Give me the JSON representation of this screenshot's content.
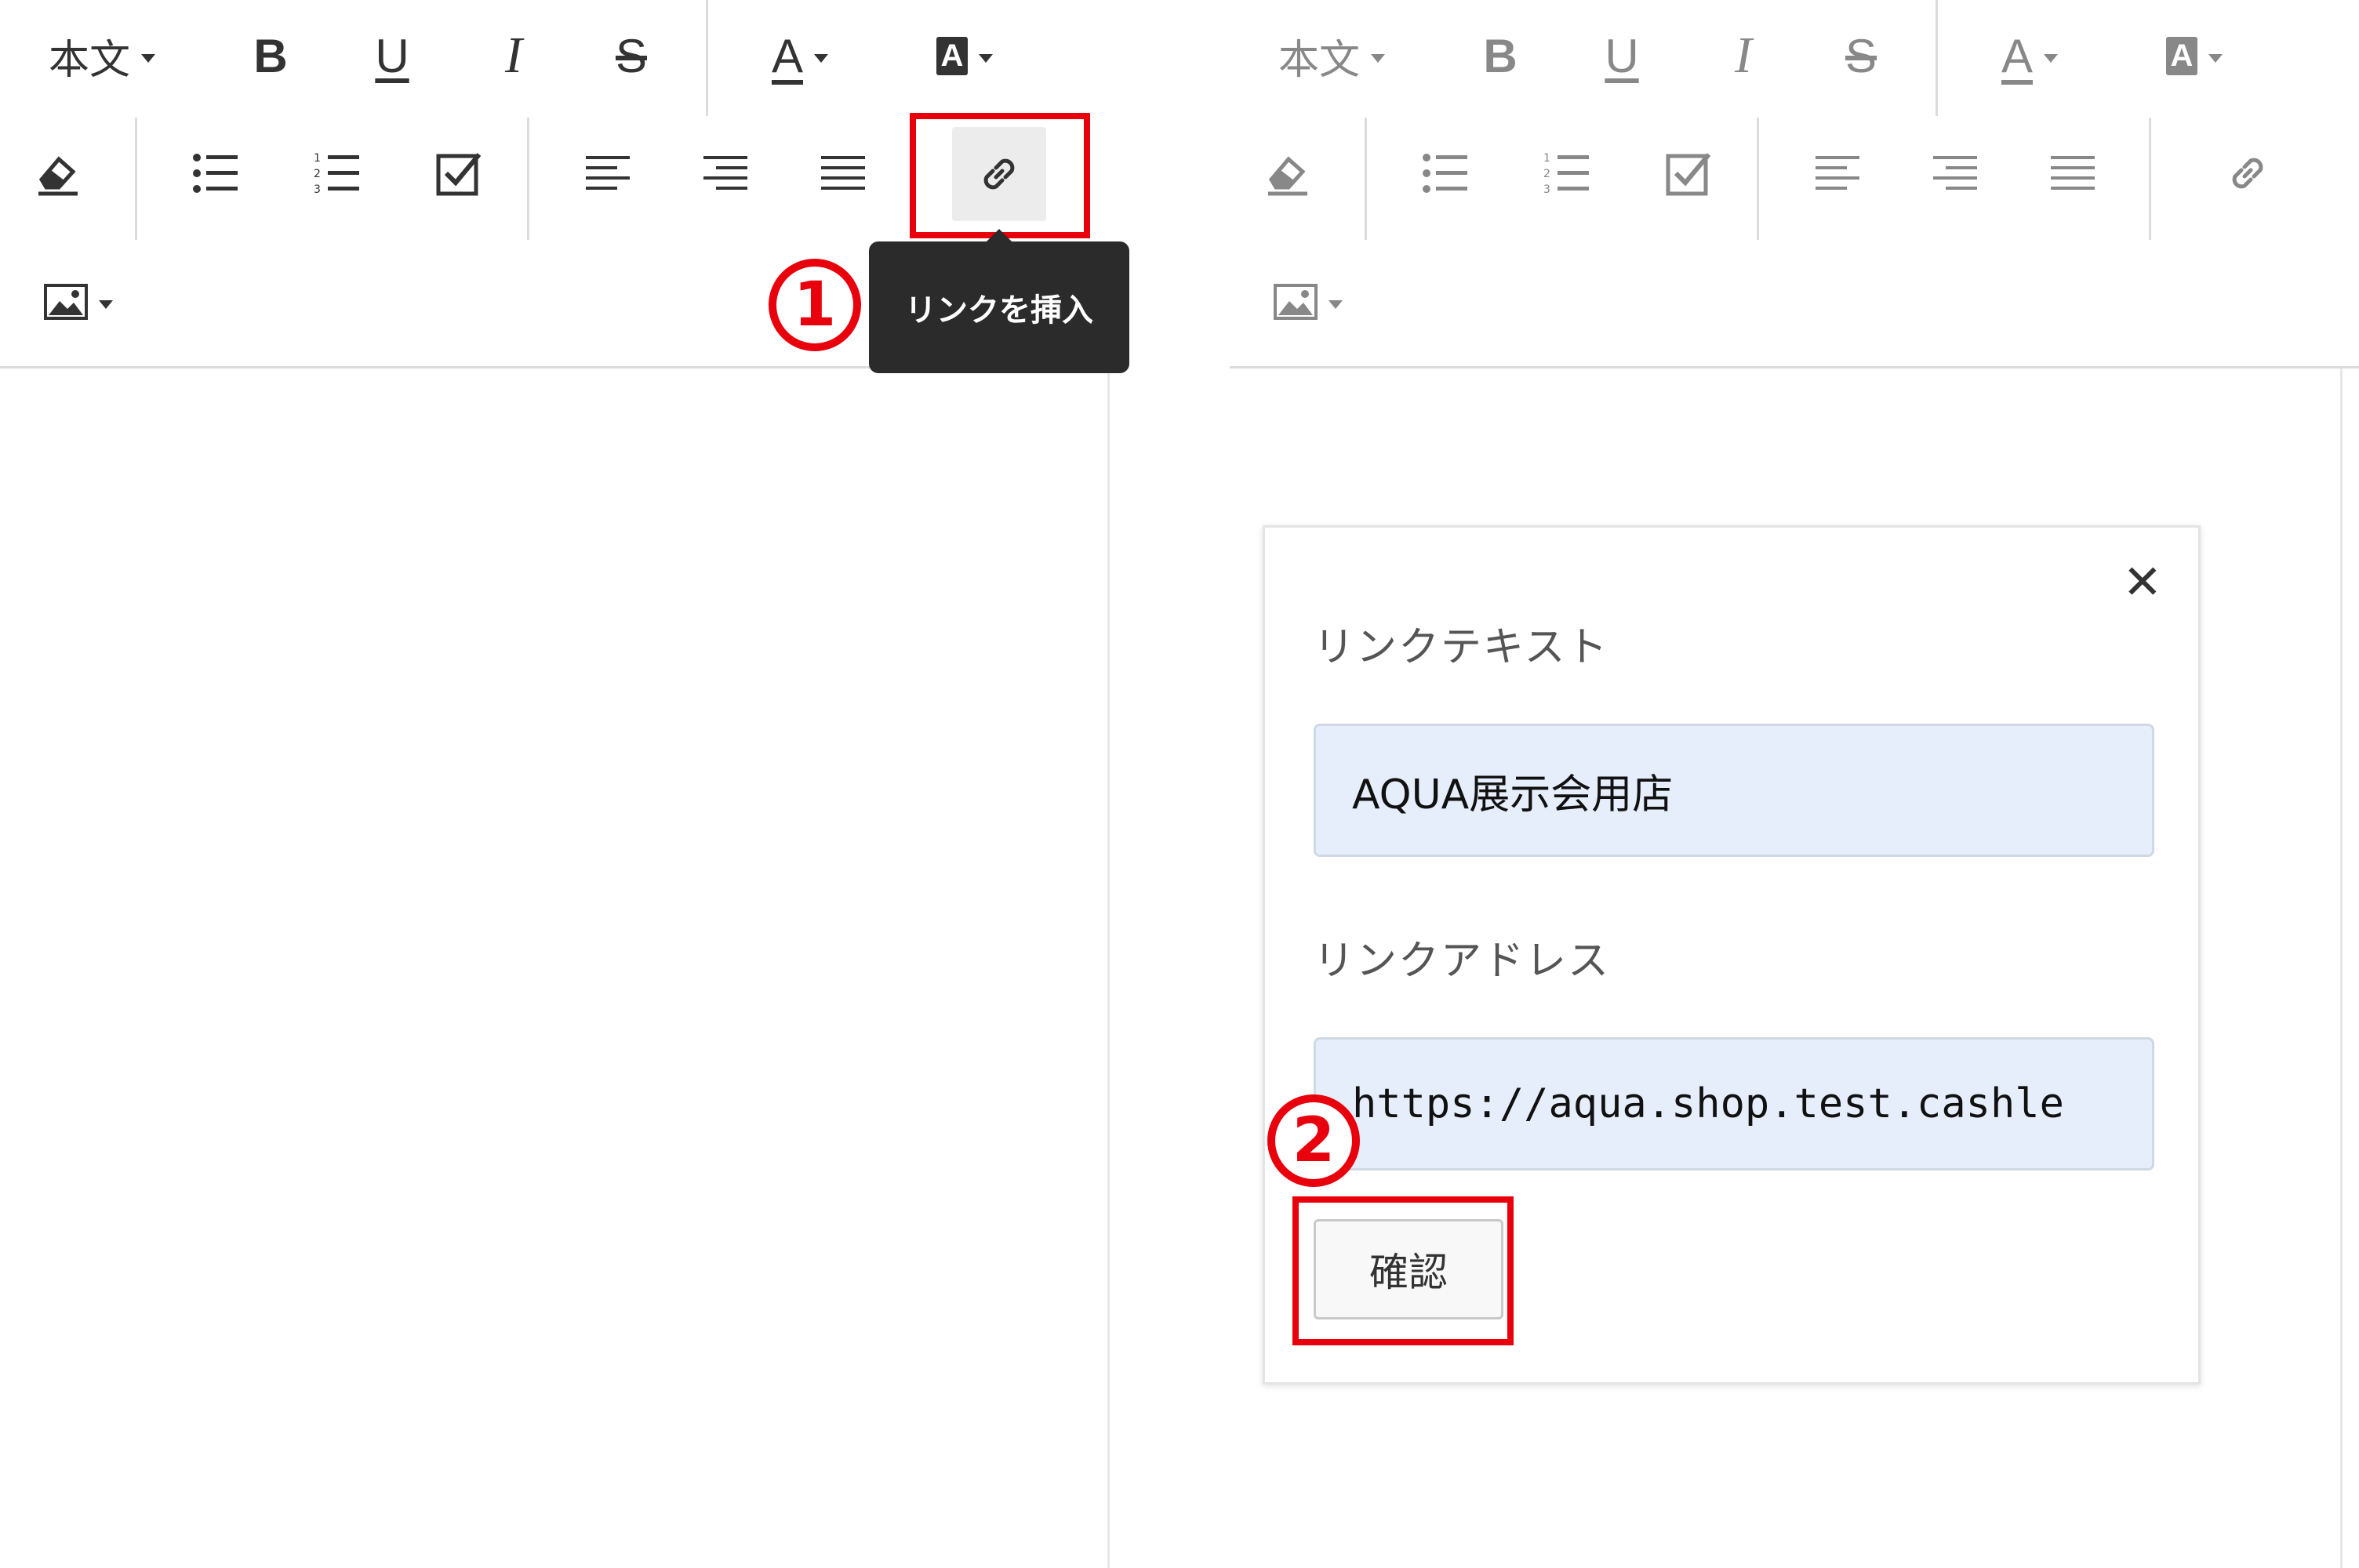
{
  "toolbar": {
    "paragraph_style_label": "本文",
    "buttons": {
      "bold": "B",
      "underline": "U",
      "italic": "I",
      "strikethrough": "S",
      "font_color": "A",
      "highlight": "A"
    },
    "icons": [
      "bold-icon",
      "underline-icon",
      "italic-icon",
      "strikethrough-icon",
      "font-color-icon",
      "highlight-color-icon",
      "eraser-icon",
      "bullet-list-icon",
      "numbered-list-icon",
      "checkbox-icon",
      "align-left-icon",
      "align-right-icon",
      "align-justify-icon",
      "link-icon",
      "image-icon"
    ]
  },
  "tooltip": {
    "text": "リンクを挿入"
  },
  "annotations": {
    "step1": "1",
    "step2": "2",
    "highlight_color": "#e8000c"
  },
  "dialog": {
    "link_text_label": "リンクテキスト",
    "link_text_value": "AQUA展示会用店",
    "link_address_label": "リンクアドレス",
    "link_address_value": "https://aqua.shop.test.cashle",
    "confirm_button": "確認",
    "close_symbol": "✕"
  },
  "colors": {
    "input_background": "#e6eefb",
    "tooltip_background": "#2b2b2b",
    "separator": "#dcdcdc"
  }
}
